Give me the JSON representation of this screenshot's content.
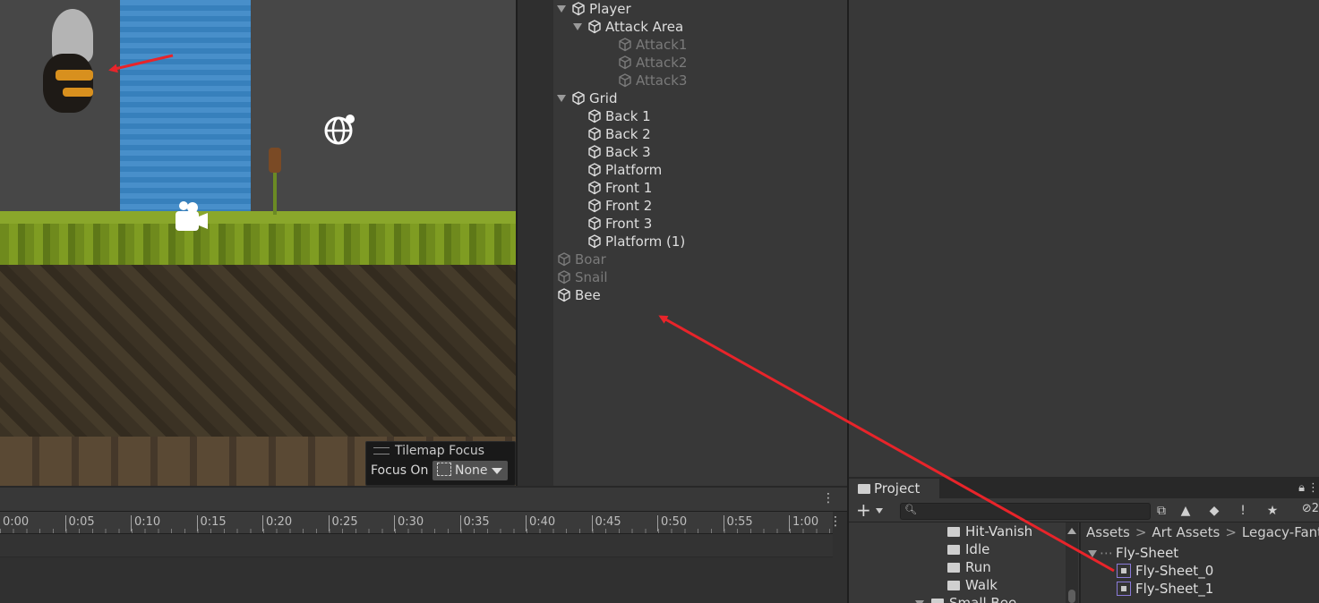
{
  "hierarchy": {
    "items": [
      {
        "label": "Player",
        "level": 0,
        "expanded": true,
        "dim": false
      },
      {
        "label": "Attack Area",
        "level": 1,
        "expanded": true,
        "dim": false
      },
      {
        "label": "Attack1",
        "level": 2,
        "dim": true
      },
      {
        "label": "Attack2",
        "level": 2,
        "dim": true
      },
      {
        "label": "Attack3",
        "level": 2,
        "dim": true
      },
      {
        "label": "Grid",
        "level": 0,
        "expanded": true,
        "dim": false
      },
      {
        "label": "Back 1",
        "level": 1,
        "dim": false
      },
      {
        "label": "Back 2",
        "level": 1,
        "dim": false
      },
      {
        "label": "Back 3",
        "level": 1,
        "dim": false
      },
      {
        "label": "Platform",
        "level": 1,
        "dim": false
      },
      {
        "label": "Front 1",
        "level": 1,
        "dim": false
      },
      {
        "label": "Front 2",
        "level": 1,
        "dim": false
      },
      {
        "label": "Front 3",
        "level": 1,
        "dim": false
      },
      {
        "label": "Platform (1)",
        "level": 1,
        "dim": false
      },
      {
        "label": "Boar",
        "level": 0,
        "dim": true
      },
      {
        "label": "Snail",
        "level": 0,
        "dim": true
      },
      {
        "label": "Bee",
        "level": 0,
        "dim": false
      }
    ]
  },
  "tilemap_focus": {
    "title": "Tilemap Focus",
    "focus_label": "Focus On",
    "focus_value": "None"
  },
  "timeline": {
    "ticks": [
      "0:00",
      "0:05",
      "0:10",
      "0:15",
      "0:20",
      "0:25",
      "0:30",
      "0:35",
      "0:40",
      "0:45",
      "0:50",
      "0:55",
      "1:00"
    ],
    "menu_icon": "⋮"
  },
  "project": {
    "tab_label": "Project",
    "search_placeholder": "",
    "tree": [
      "Hit-Vanish",
      "Idle",
      "Run",
      "Walk",
      "Small Bee"
    ],
    "breadcrumbs": [
      "Assets",
      "Art Assets",
      "Legacy-Fanta"
    ],
    "sheet": "Fly-Sheet",
    "sprites": [
      "Fly-Sheet_0",
      "Fly-Sheet_1"
    ],
    "hidden_count": "2"
  },
  "colors": {
    "annotation_arrow": "#e8242a",
    "panel_bg": "#383838",
    "scene_bg": "#474747"
  }
}
